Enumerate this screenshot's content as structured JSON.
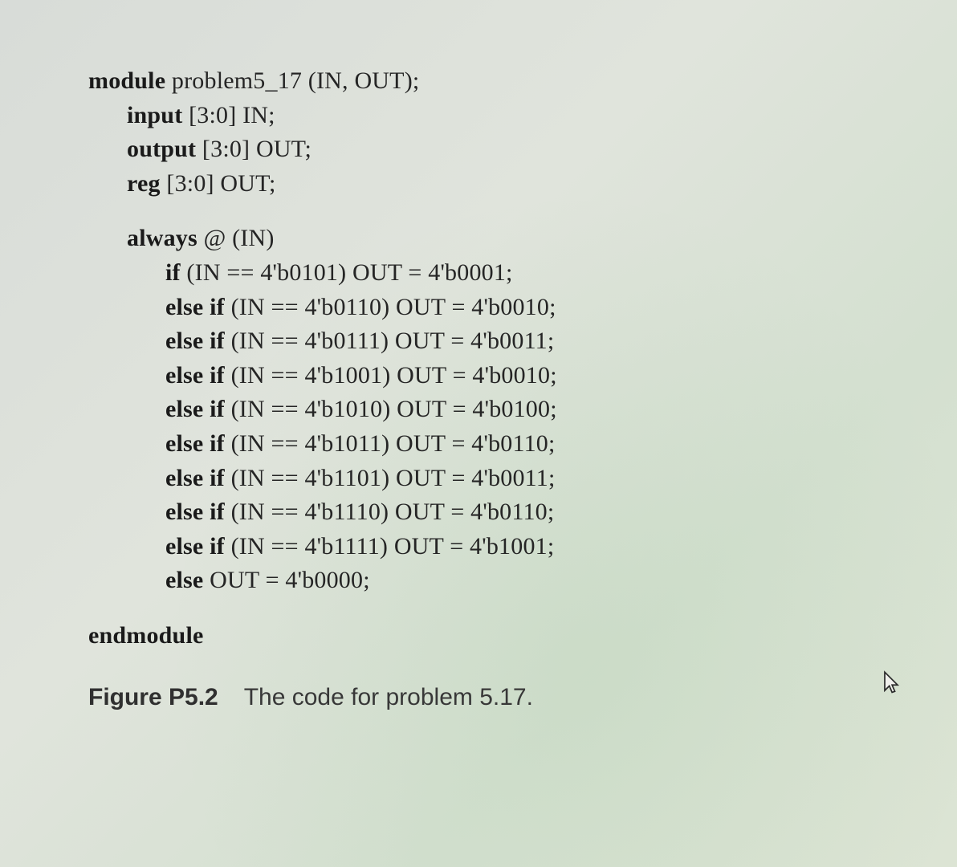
{
  "code": {
    "l1a": "module",
    "l1b": "  problem5_17 (IN, OUT);",
    "l2a": "input",
    "l2b": "  [3:0] IN;",
    "l3a": "output",
    "l3b": "  [3:0] OUT;",
    "l4a": "reg",
    "l4b": "  [3:0] OUT;",
    "l5a": "always",
    "l5b": " @ (IN)",
    "l6a": "if",
    "l6b": " (IN == 4'b0101)   OUT = 4'b0001;",
    "l7a": "else if",
    "l7b": " (IN == 4'b0110)   OUT = 4'b0010;",
    "l8a": "else if",
    "l8b": " (IN == 4'b0111)   OUT = 4'b0011;",
    "l9a": "else if",
    "l9b": " (IN == 4'b1001)   OUT = 4'b0010;",
    "l10a": "else if",
    "l10b": " (IN == 4'b1010)   OUT = 4'b0100;",
    "l11a": "else if",
    "l11b": " (IN == 4'b1011)   OUT = 4'b0110;",
    "l12a": "else if",
    "l12b": " (IN == 4'b1101)   OUT = 4'b0011;",
    "l13a": "else if",
    "l13b": " (IN == 4'b1110)   OUT = 4'b0110;",
    "l14a": "else if",
    "l14b": " (IN == 4'b1111)   OUT = 4'b1001;",
    "l15a": "else",
    "l15b": "   OUT = 4'b0000;",
    "l16": "endmodule"
  },
  "caption": {
    "label": "Figure P5.2",
    "text": "The code for problem 5.17."
  }
}
